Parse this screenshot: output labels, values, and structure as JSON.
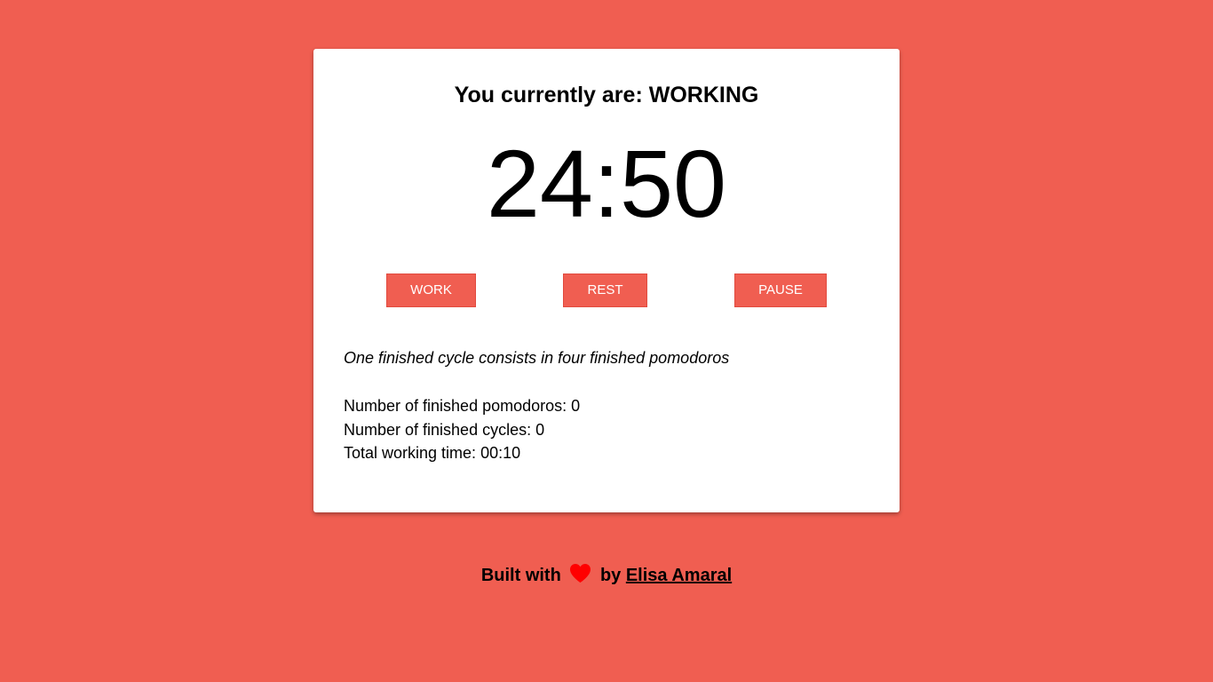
{
  "status": {
    "label": "You currently are: ",
    "state": "WORKING"
  },
  "timer": {
    "display": "24:50"
  },
  "buttons": {
    "work": "WORK",
    "rest": "REST",
    "pause": "PAUSE"
  },
  "note": "One finished cycle consists in four finished pomodoros",
  "stats": {
    "pomodoros_label": "Number of finished pomodoros: ",
    "pomodoros_value": "0",
    "cycles_label": "Number of finished cycles: ",
    "cycles_value": "0",
    "working_time_label": "Total working time: ",
    "working_time_value": "00:10"
  },
  "footer": {
    "prefix": "Built with",
    "icon": "heart-icon",
    "middle": "by",
    "author": "Elisa Amaral"
  },
  "colors": {
    "background": "#f05e51",
    "button": "#f05e51",
    "heart": "#ff0000"
  }
}
